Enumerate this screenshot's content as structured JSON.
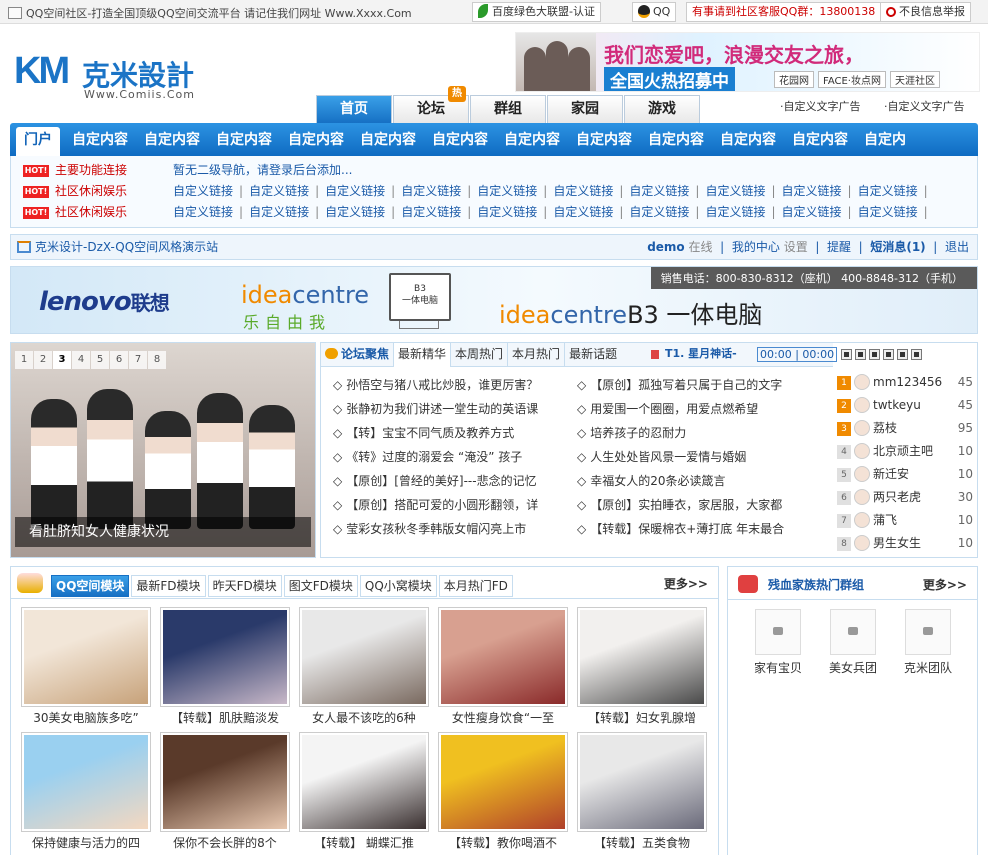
{
  "topbar": {
    "slogan": "QQ空间社区-打造全国顶级QQ空间交流平台 请记住我们网址 Www.Xxxx.Com",
    "alliance": "百度绿色大联盟-认证",
    "qq": "QQ",
    "service": "有事请到社区客服QQ群：13800138",
    "report": "不良信息举报"
  },
  "logo": {
    "mark": "KM",
    "name": "克米設計",
    "url": "Www.Comiis.Com"
  },
  "top_ad": {
    "line1": "我们恋爱吧，浪漫交友之旅，",
    "line2": "全国火热招募中",
    "brands": [
      "花园网",
      "FACE·妆点网",
      "天涯社区"
    ]
  },
  "main_nav": [
    {
      "label": "首页",
      "active": true
    },
    {
      "label": "论坛",
      "badge": "热"
    },
    {
      "label": "群组"
    },
    {
      "label": "家园"
    },
    {
      "label": "游戏"
    }
  ],
  "ad_texts": [
    "·自定义文字广告",
    "·自定义文字广告"
  ],
  "channel_nav": [
    "门户",
    "自定内容",
    "自定内容",
    "自定内容",
    "自定内容",
    "自定内容",
    "自定内容",
    "自定内容",
    "自定内容",
    "自定内容",
    "自定内容",
    "自定内容",
    "自定内"
  ],
  "subnav": {
    "hot_badge": "HOT!",
    "rows": [
      {
        "category": "主要功能连接",
        "note": "暂无二级导航，请登录后台添加..."
      },
      {
        "category": "社区休闲娱乐",
        "link": "自定义链接",
        "count": 10
      },
      {
        "category": "社区休闲娱乐",
        "link": "自定义链接",
        "count": 10
      }
    ]
  },
  "userbar": {
    "site": "克米设计-DzX-QQ空间风格演示站",
    "user": "demo",
    "online": "在线",
    "center": "我的中心",
    "settings": "设置",
    "remind": "提醒",
    "messages": "短消息(1)",
    "logout": "退出"
  },
  "banner": {
    "brand": "lenovo",
    "brand_cn": "联想",
    "idea1": "idea",
    "idea2": "centre",
    "slogan": "乐自由我",
    "monitor": "B3\n一体电脑",
    "product_suffix": "B3 一体电脑",
    "phone": "销售电话：800-830-8312（座机） 400-8848-312（手机）"
  },
  "slideshow": {
    "pages": [
      "1",
      "2",
      "3",
      "4",
      "5",
      "6",
      "7",
      "8"
    ],
    "active_page": 3,
    "caption": "看肚脐知女人健康状况"
  },
  "forum": {
    "title": "论坛聚焦",
    "tabs": [
      "最新精华",
      "本周热门",
      "本月热门",
      "最新话题"
    ],
    "music": {
      "song": "T1. 星月神话-",
      "time": "00:00 | 00:00"
    },
    "threads": [
      [
        "孙悟空与猪八戒比炒股，谁更厉害？",
        "【原创】孤独写着只属于自己的文字"
      ],
      [
        "张静初为我们讲述一堂生动的英语课",
        "用爱围一个圈圈，用爱点燃希望"
      ],
      [
        "【转】宝宝不同气质及教养方式",
        "培养孩子的忍耐力"
      ],
      [
        "《转》过度的溺爱会 “淹没” 孩子",
        "人生处处皆风景一爱情与婚姻"
      ],
      [
        "【原创】[曾经的美好]---悲念的记忆",
        "幸福女人的20条必读箴言"
      ],
      [
        "【原创】搭配可爱的小圆形翻领，详",
        "【原创】实拍睡衣，家居服，大家都"
      ],
      [
        "莹彩女孩秋冬季韩版女帽闪亮上市",
        "【转载】保暖棉衣+薄打底 年末最合"
      ]
    ],
    "ranking": [
      {
        "rank": "1",
        "name": "mm123456",
        "score": "45"
      },
      {
        "rank": "2",
        "name": "twtkeyu",
        "score": "45"
      },
      {
        "rank": "3",
        "name": "荔枝",
        "score": "95"
      },
      {
        "rank": "4",
        "name": "北京顽主吧",
        "score": "10"
      },
      {
        "rank": "5",
        "name": "新迁安",
        "score": "10"
      },
      {
        "rank": "6",
        "name": "两只老虎",
        "score": "30"
      },
      {
        "rank": "7",
        "name": "蒲飞",
        "score": "10"
      },
      {
        "rank": "8",
        "name": "男生女生",
        "score": "10"
      }
    ]
  },
  "fd_module": {
    "tabs": [
      "QQ空间模块",
      "最新FD模块",
      "昨天FD模块",
      "图文FD模块",
      "QQ小窝模块",
      "本月热门FD"
    ],
    "more": "更多>>",
    "items": [
      {
        "caption": "30美女电脑族多吃”",
        "c1": "#f2e6d8",
        "c2": "#c7a27a"
      },
      {
        "caption": "【转载】肌肤黯淡发",
        "c1": "#2a3a6a",
        "c2": "#c8b8c8"
      },
      {
        "caption": "女人最不该吃的6种",
        "c1": "#e8e8e8",
        "c2": "#7a6a60"
      },
      {
        "caption": "女性瘦身饮食“一至",
        "c1": "#d8a090",
        "c2": "#8a2a2a"
      },
      {
        "caption": "【转载】妇女乳腺增",
        "c1": "#f2f0ee",
        "c2": "#4a4a4a"
      },
      {
        "caption": "保持健康与活力的四",
        "c1": "#9ad0f0",
        "c2": "#f4d8c0"
      },
      {
        "caption": "保你不会长胖的8个",
        "c1": "#5a3a2a",
        "c2": "#e8c8b0"
      },
      {
        "caption": "【转载】 蝴蝶汇推",
        "c1": "#f4f4f4",
        "c2": "#3a3030"
      },
      {
        "caption": "【转载】教你喝酒不",
        "c1": "#f0c020",
        "c2": "#b0402a"
      },
      {
        "caption": "【转载】五类食物",
        "c1": "#e8e8e8",
        "c2": "#6a6a7a"
      }
    ]
  },
  "groups": {
    "title": "残血家族热门群组",
    "more": "更多>>",
    "items": [
      "家有宝贝",
      "美女兵团",
      "克米团队"
    ]
  }
}
